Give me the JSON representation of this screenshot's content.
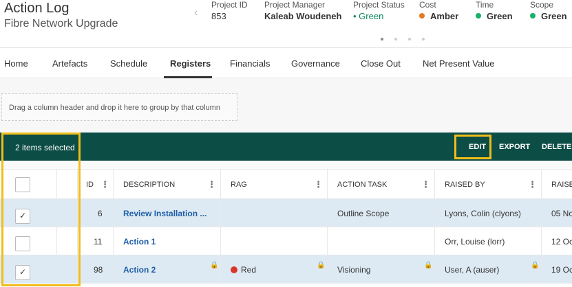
{
  "header": {
    "title": "Action Log",
    "subtitle": "Fibre Network Upgrade",
    "kpis": {
      "project_id": {
        "label": "Project ID",
        "value": "853"
      },
      "manager": {
        "label": "Project Manager",
        "value": "Kaleab Woudeneh"
      },
      "status": {
        "label": "Project Status",
        "value": "Green",
        "color": "#0b8a5a"
      },
      "cost": {
        "label": "Cost",
        "value": "Amber",
        "color": "#e07b24"
      },
      "time": {
        "label": "Time",
        "value": "Green",
        "color": "#17b26a"
      },
      "scope": {
        "label": "Scope",
        "value": "Green",
        "color": "#17b26a"
      }
    },
    "nav_prev_icon": "chevron-left-icon"
  },
  "nav": {
    "tabs": [
      "Home",
      "Artefacts",
      "Schedule",
      "Registers",
      "Financials",
      "Governance",
      "Close Out",
      "Net Present Value"
    ],
    "active": "Registers"
  },
  "group_area": {
    "text": "Drag a column header and drop it here to group by that column"
  },
  "toolbar": {
    "selected_text": "2 items selected",
    "edit": "EDIT",
    "export": "EXPORT",
    "delete": "DELETE",
    "bg_color": "#0c4d45"
  },
  "grid": {
    "columns": {
      "id": "ID",
      "description": "DESCRIPTION",
      "rag": "RAG",
      "action_task": "ACTION TASK",
      "raised_by": "RAISED BY",
      "raised_date": "RAISE"
    },
    "rows": [
      {
        "selected": true,
        "id": "6",
        "description": "Review Installation ...",
        "rag": "",
        "action_task": "Outline Scope",
        "raised_by": "Lyons, Colin (clyons)",
        "raised_date": "05 No"
      },
      {
        "selected": false,
        "id": "11",
        "description": "Action 1",
        "rag": "",
        "action_task": "",
        "raised_by": "Orr, Louise (lorr)",
        "raised_date": "12 Oc"
      },
      {
        "selected": true,
        "id": "98",
        "description": "Action 2",
        "rag": "Red",
        "action_task": "Visioning",
        "raised_by": "User, A (auser)",
        "raised_date": "19 Oc"
      }
    ]
  },
  "highlight_color": "#f1bd1b"
}
